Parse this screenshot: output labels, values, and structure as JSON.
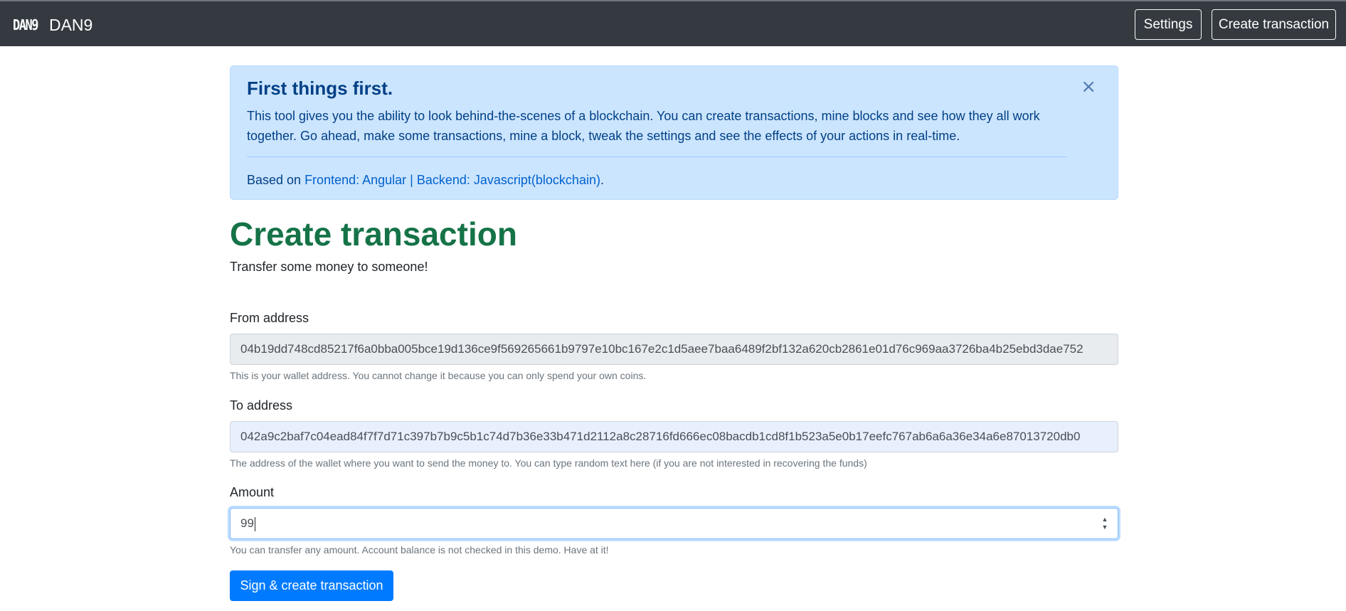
{
  "navbar": {
    "logo_text": "DAN9",
    "brand_name": "DAN9",
    "settings_label": "Settings",
    "create_label": "Create transaction"
  },
  "alert": {
    "heading": "First things first.",
    "text": "This tool gives you the ability to look behind-the-scenes of a blockchain. You can create transactions, mine blocks and see how they all work together. Go ahead, make some transactions, mine a block, tweak the settings and see the effects of your actions in real-time.",
    "footer_prefix": "Based on ",
    "footer_link": "Frontend: Angular | Backend: Javascript(blockchain)",
    "footer_suffix": ".",
    "close_symbol": "×"
  },
  "page": {
    "title": "Create transaction",
    "subtitle": "Transfer some money to someone!"
  },
  "form": {
    "from": {
      "label": "From address",
      "value": "04b19dd748cd85217f6a0bba005bce19d136ce9f569265661b9797e10bc167e2c1d5aee7baa6489f2bf132a620cb2861e01d76c969aa3726ba4b25ebd3dae752",
      "help": "This is your wallet address. You cannot change it because you can only spend your own coins."
    },
    "to": {
      "label": "To address",
      "value": "042a9c2baf7c04ead84f7f7d71c397b7b9c5b1c74d7b36e33b471d2112a8c28716fd666ec08bacdb1cd8f1b523a5e0b17eefc767ab6a6a36e34a6e87013720db0",
      "help": "The address of the wallet where you want to send the money to. You can type random text here (if you are not interested in recovering the funds)"
    },
    "amount": {
      "label": "Amount",
      "value": "99",
      "help": "You can transfer any amount. Account balance is not checked in this demo. Have at it!"
    },
    "submit_label": "Sign & create transaction"
  }
}
